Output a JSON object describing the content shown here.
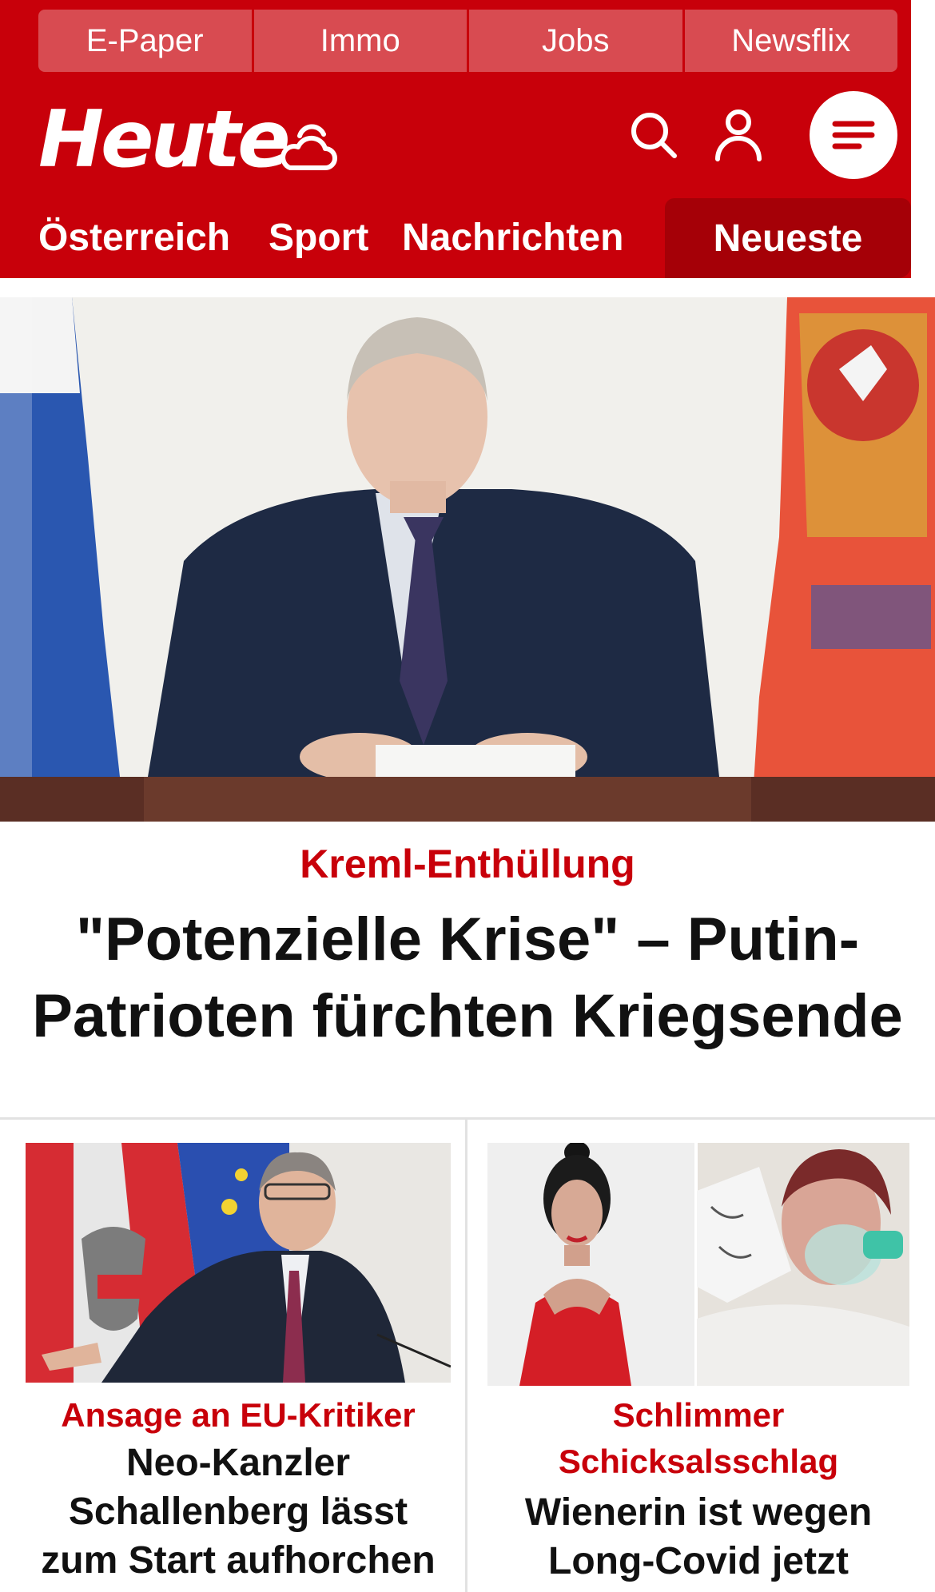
{
  "topbar": {
    "links": [
      "E-Paper",
      "Immo",
      "Jobs",
      "Newsflix"
    ]
  },
  "brand": {
    "logo_text": "Heute",
    "color": "#c8000a"
  },
  "icons": {
    "weather": "weather-cloud-sun-icon",
    "search": "search-icon",
    "user": "user-icon",
    "menu": "menu-icon"
  },
  "nav": {
    "items": [
      "Österreich",
      "Sport",
      "Nachrichten"
    ],
    "active": "Neueste"
  },
  "hero": {
    "kicker": "Kreml-Enthüllung",
    "title": "\"Potenzielle Krise\" – Putin-Patrioten fürchten Kriegsende"
  },
  "cards": [
    {
      "kicker": "Ansage an EU-Kritiker",
      "title": "Neo-Kanzler Schallenberg lässt zum Start aufhorchen"
    },
    {
      "kicker": "Schlimmer Schicksalsschlag",
      "title": "Wienerin ist wegen Long-Covid jetzt"
    }
  ]
}
